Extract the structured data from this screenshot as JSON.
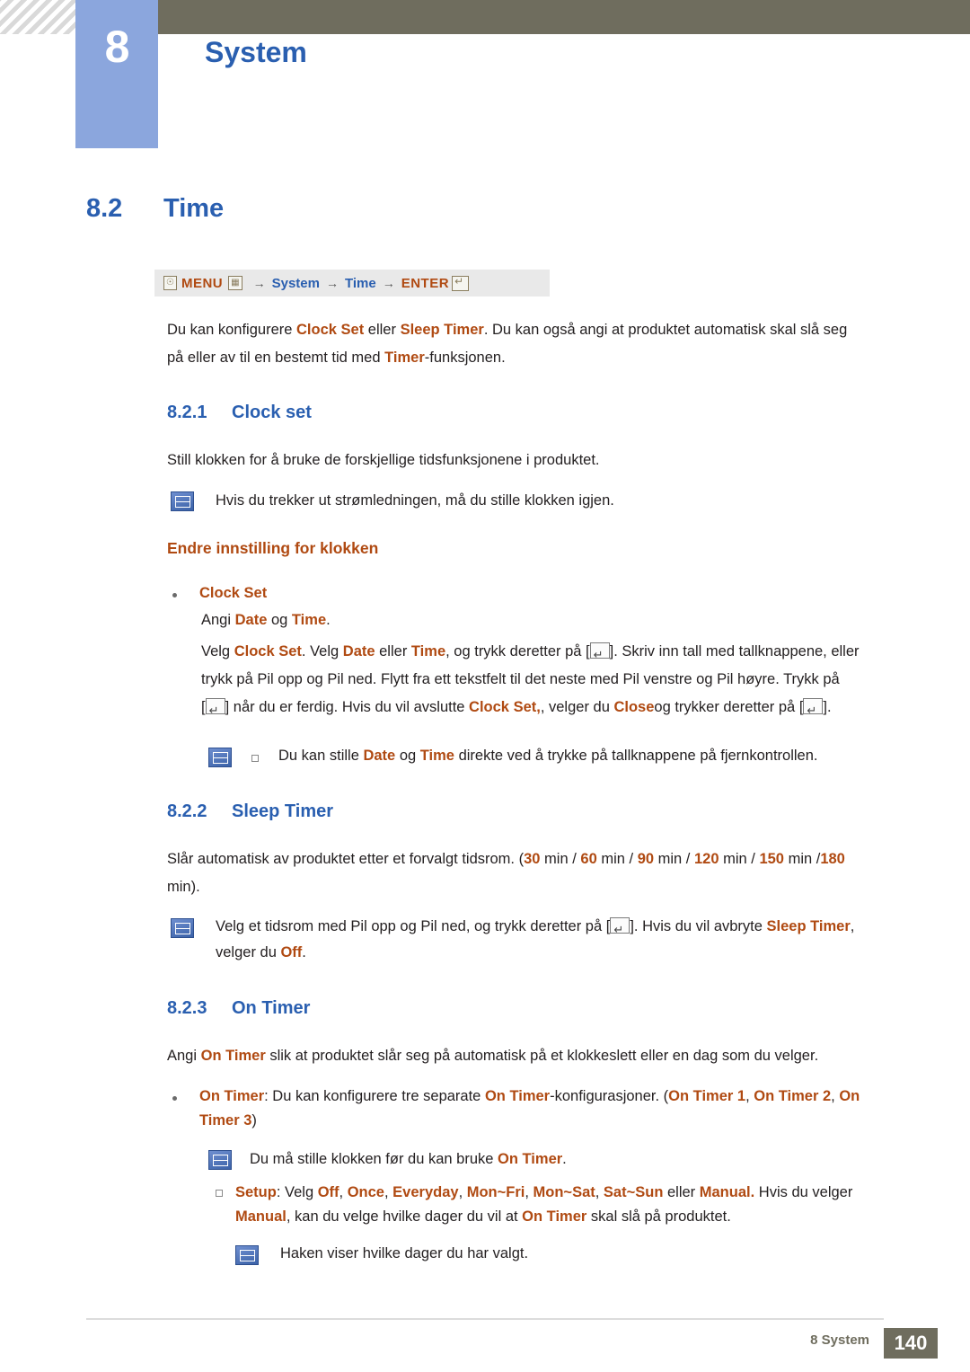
{
  "header": {
    "chapter_number": "8",
    "chapter_title": "System"
  },
  "section": {
    "number": "8.2",
    "title": "Time"
  },
  "menu_path": {
    "menu_label": "MENU",
    "menu_icon": "menu-grid-icon",
    "system_label": "System",
    "time_label": "Time",
    "enter_label": "ENTER",
    "arrow": "→"
  },
  "intro": {
    "line1_a": "Du kan konfigurere ",
    "line1_kw1": "Clock Set",
    "line1_b": " eller ",
    "line1_kw2": "Sleep Timer",
    "line1_c": ". Du kan også angi at produktet automatisk skal slå seg",
    "line2_a": "på eller av til en bestemt tid med ",
    "line2_kw": "Timer",
    "line2_b": "-funksjonen."
  },
  "clock_set": {
    "heading_num": "8.2.1",
    "heading_title": "Clock set",
    "desc": "Still klokken for å bruke de forskjellige tidsfunksjonene i produktet.",
    "note1": "Hvis du trekker ut strømledningen, må du stille klokken igjen.",
    "orange_head": "Endre innstilling for klokken",
    "bullet_label": "Clock Set",
    "angi_a": "Angi ",
    "angi_date": "Date",
    "angi_og": " og ",
    "angi_time": "Time",
    "angi_end": ".",
    "body_l1_a": "Velg ",
    "body_l1_kw1": "Clock Set",
    "body_l1_b": ". Velg ",
    "body_l1_kw2": "Date",
    "body_l1_c": " eller ",
    "body_l1_kw3": "Time",
    "body_l1_d": ", og trykk deretter på [",
    "body_l1_e": "]. Skriv inn tall med tallknappene, eller",
    "body_l2": "trykk på Pil opp og Pil ned. Flytt fra ett tekstfelt til det neste med Pil venstre og Pil høyre. Trykk på",
    "body_l3_a": "[",
    "body_l3_b": "] når du er ferdig. Hvis du vil avslutte ",
    "body_l3_kw1": "Clock Set,",
    "body_l3_c": ", velger du ",
    "body_l3_kw2": "Close",
    "body_l3_d": "og trykker deretter på [",
    "body_l3_e": "].",
    "note2_a": "Du kan stille ",
    "note2_kw1": "Date",
    "note2_b": " og ",
    "note2_kw2": "Time",
    "note2_c": " direkte ved å trykke på tallknappene på fjernkontrollen."
  },
  "sleep_timer": {
    "heading_num": "8.2.2",
    "heading_title": "Sleep Timer",
    "desc_a": "Slår automatisk av produktet etter et forvalgt tidsrom. (",
    "v30": "30",
    "min1": " min / ",
    "v60": "60",
    "min2": " min / ",
    "v90": "90",
    "min3": " min / ",
    "v120": "120",
    "min4": " min / ",
    "v150": "150",
    "min5": " min /",
    "v180": "180",
    "desc_line2": "min).",
    "note_a": "Velg et tidsrom med Pil opp og Pil ned, og trykk deretter på [",
    "note_b": "]. Hvis du vil avbryte ",
    "note_kw": "Sleep Timer",
    "note_c": ",",
    "note_line2_a": "velger du ",
    "note_line2_kw": "Off",
    "note_line2_b": "."
  },
  "on_timer": {
    "heading_num": "8.2.3",
    "heading_title": "On Timer",
    "desc_a": "Angi ",
    "desc_kw": "On Timer",
    "desc_b": " slik at produktet slår seg på automatisk på et klokkeslett eller en dag som du velger.",
    "b1_kw1": "On Timer",
    "b1_a": ": Du kan konfigurere tre separate ",
    "b1_kw2": "On Timer",
    "b1_b": "-konfigurasjoner. (",
    "b1_kw3": "On Timer 1",
    "b1_c": ", ",
    "b1_kw4": "On Timer 2",
    "b1_d": ", ",
    "b1_kw5": "On",
    "b1_line2_kw": "Timer 3",
    "b1_line2_a": ")",
    "note_a": "Du må stille klokken før du kan bruke ",
    "note_kw": "On Timer",
    "note_b": ".",
    "setup_kw": "Setup",
    "setup_a": ": Velg ",
    "setup_off": "Off",
    "setup_c1": ", ",
    "setup_once": "Once",
    "setup_c2": ", ",
    "setup_everyday": "Everyday",
    "setup_c3": ", ",
    "setup_monfri": "Mon~Fri",
    "setup_c4": ", ",
    "setup_monsat": "Mon~Sat",
    "setup_c5": ", ",
    "setup_satsun": "Sat~Sun",
    "setup_eller": " eller ",
    "setup_manual": "Manual.",
    "setup_tail": " Hvis du velger",
    "setup_l2_kw": "Manual",
    "setup_l2_a": ", kan du velge hvilke dager du vil at ",
    "setup_l2_kw2": "On Timer",
    "setup_l2_b": " skal slå på produktet.",
    "note2": "Haken viser hvilke dager du har valgt."
  },
  "footer": {
    "text": "8 System",
    "page": "140"
  },
  "colors": {
    "blue_heading": "#2a5fb0",
    "orange_keyword": "#b04a12",
    "band": "#6f6d5e",
    "chapter_box": "#8ba6dd"
  }
}
